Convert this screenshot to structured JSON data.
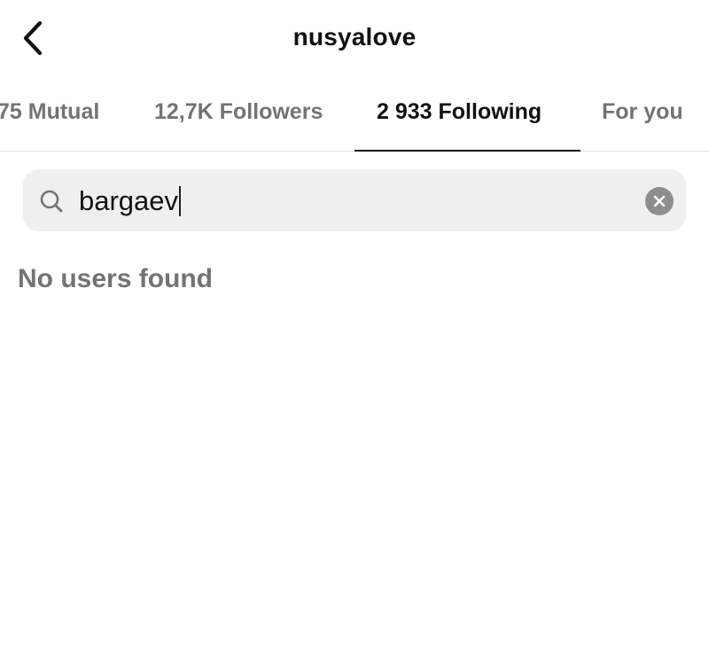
{
  "header": {
    "title": "nusyalove",
    "back_icon": "chevron-left-icon"
  },
  "tabs": [
    {
      "label": "75 Mutual",
      "active": false
    },
    {
      "label": "12,7K Followers",
      "active": false
    },
    {
      "label": "2 933 Following",
      "active": true
    },
    {
      "label": "For you",
      "active": false
    }
  ],
  "search": {
    "value": "bargaev",
    "search_icon": "search-icon",
    "clear_icon": "clear-icon"
  },
  "results": {
    "empty_message": "No users found"
  },
  "colors": {
    "text_primary": "#111111",
    "text_secondary": "#737373",
    "search_background": "#efefef",
    "clear_button": "#8e8e8e",
    "divider": "#dbdbdb"
  }
}
